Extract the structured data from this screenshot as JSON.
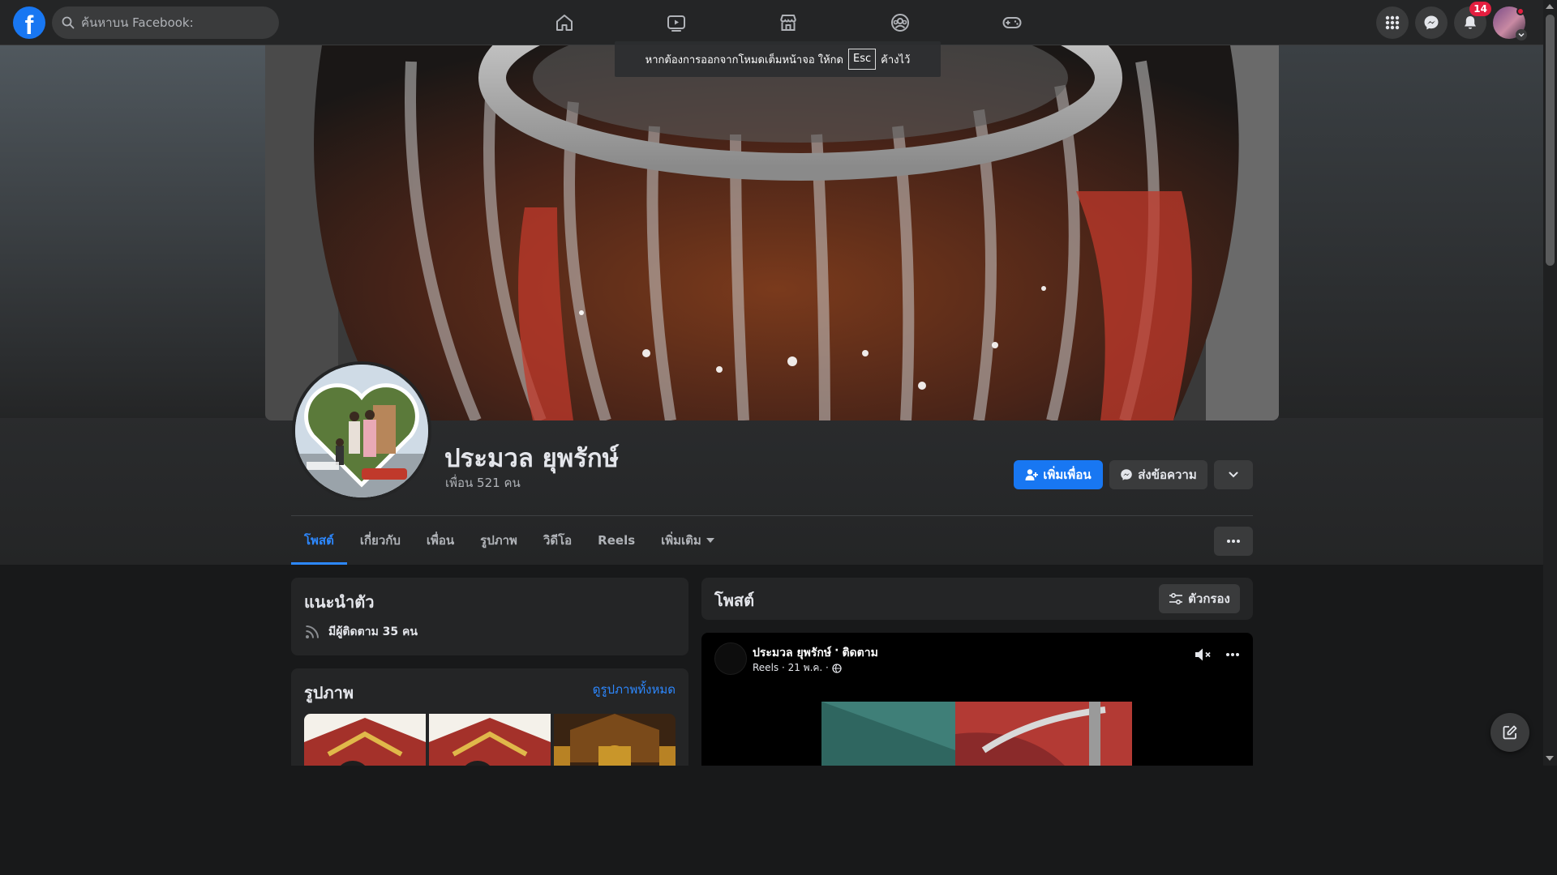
{
  "topnav": {
    "logo_letter": "f",
    "search_placeholder": "ค้นหาบน Facebook:",
    "notification_count": "14",
    "nav_icons": [
      "home-icon",
      "watch-icon",
      "marketplace-icon",
      "groups-icon",
      "gaming-icon"
    ],
    "right_icons": [
      "menu-grid-icon",
      "messenger-icon",
      "bell-icon",
      "account-avatar"
    ]
  },
  "fullscreen_toast": {
    "before": "หากต้องการออกจากโหมดเต็มหน้าจอ ให้กด",
    "key": "Esc",
    "after": "ค้างไว้"
  },
  "profile": {
    "name": "ประมวล ยุพรักษ์",
    "friends": "เพื่อน 521 คน"
  },
  "actions": {
    "add_friend": "เพิ่มเพื่อน",
    "message": "ส่งข้อความ"
  },
  "tabs": [
    {
      "label": "โพสต์"
    },
    {
      "label": "เกี่ยวกับ"
    },
    {
      "label": "เพื่อน"
    },
    {
      "label": "รูปภาพ"
    },
    {
      "label": "วิดีโอ"
    },
    {
      "label": "Reels"
    },
    {
      "label": "เพิ่มเติม"
    }
  ],
  "intro": {
    "title": "แนะนำตัว",
    "followers": "มีผู้ติดตาม 35 คน"
  },
  "photos": {
    "title": "รูปภาพ",
    "see_all": "ดูรูปภาพทั้งหมด"
  },
  "posts": {
    "title": "โพสต์",
    "filter": "ตัวกรอง"
  },
  "post": {
    "author": "ประมวล ยุพรักษ์",
    "separator": "·",
    "follow": "ติดตาม",
    "meta": "Reels · 21 พ.ค. ·"
  },
  "colors": {
    "background": "#18191a",
    "surface": "#242526",
    "accent": "#1877f2",
    "active_tab": "#2d88ff",
    "badge": "#e41e3f"
  }
}
